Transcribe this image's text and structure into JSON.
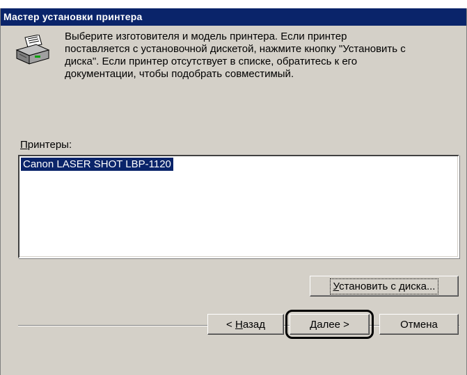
{
  "window": {
    "title": "Мастер установки принтера"
  },
  "header": {
    "icon": "printer-icon",
    "instruction": "Выберите изготовителя и модель принтера. Если принтер\nпоставляется с установочной дискетой, нажмите кнопку \"Установить с\nдиска\". Если принтер отсутствует в списке, обратитесь к его\nдокументации, чтобы подобрать совместимый."
  },
  "printers": {
    "label_underlined": "П",
    "label_rest": "ринтеры:",
    "items": [
      {
        "label": "Canon LASER SHOT LBP-1120",
        "selected": true
      }
    ]
  },
  "buttons": {
    "have_disk_underlined": "У",
    "have_disk_rest": "становить с диска...",
    "back_prefix": "< ",
    "back_underlined": "Н",
    "back_rest": "азад",
    "next": "Далее >",
    "cancel": "Отмена"
  },
  "colors": {
    "titlebar": "#0a246a",
    "dialog_bg": "#d4d0c8",
    "selection": "#0a246a"
  }
}
